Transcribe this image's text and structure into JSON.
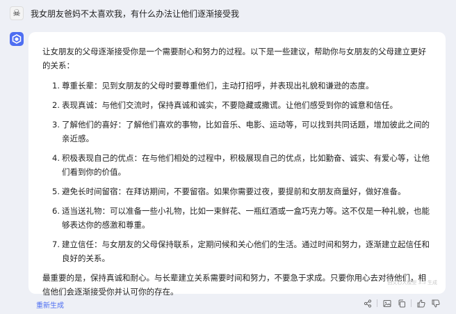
{
  "user": {
    "avatar_icon": "skull-pirate-icon",
    "question": "我女朋友爸妈不太喜欢我，有什么办法让他们逐渐接受我"
  },
  "bot": {
    "avatar_icon": "cube-logo-icon",
    "accent_color": "#4e6ef2"
  },
  "answer": {
    "intro": "让女朋友的父母逐渐接受你是一个需要耐心和努力的过程。以下是一些建议，帮助你与女朋友的父母建立更好的关系：",
    "items": [
      {
        "num": "1.",
        "text": "尊重长辈：见到女朋友的父母时要尊重他们，主动打招呼，并表现出礼貌和谦逊的态度。"
      },
      {
        "num": "2.",
        "text": "表现真诚：与他们交流时，保持真诚和诚实，不要隐藏或撒谎。让他们感受到你的诚意和信任。"
      },
      {
        "num": "3.",
        "text": "了解他们的喜好：了解他们喜欢的事物，比如音乐、电影、运动等，可以找到共同话题，增加彼此之间的亲近感。"
      },
      {
        "num": "4.",
        "text": "积极表现自己的优点：在与他们相处的过程中，积极展现自己的优点，比如勤奋、诚实、有爱心等，让他们看到你的价值。"
      },
      {
        "num": "5.",
        "text": "避免长时间留宿：在拜访期间，不要留宿。如果你需要过夜，要提前和女朋友商量好，做好准备。"
      },
      {
        "num": "6.",
        "text": "适当送礼物：可以准备一些小礼物，比如一束鲜花、一瓶红酒或一盒巧克力等。这不仅是一种礼貌，也能够表达你的感激和尊重。"
      },
      {
        "num": "7.",
        "text": "建立信任：与女朋友的父母保持联系，定期问候和关心他们的生活。通过时间和努力，逐渐建立起信任和良好的关系。"
      }
    ],
    "conclusion": "最重要的是，保持真诚和耐心。与长辈建立关系需要时间和努力，不要急于求成。只要你用心去对待他们，相信他们会逐渐接受你并认可你的存在。",
    "watermark": "由文心大模型 3.5 生成"
  },
  "footer": {
    "regenerate_label": "重新生成",
    "actions": [
      "share-icon",
      "image-icon",
      "copy-icon",
      "thumbs-up-icon",
      "thumbs-down-icon"
    ]
  }
}
